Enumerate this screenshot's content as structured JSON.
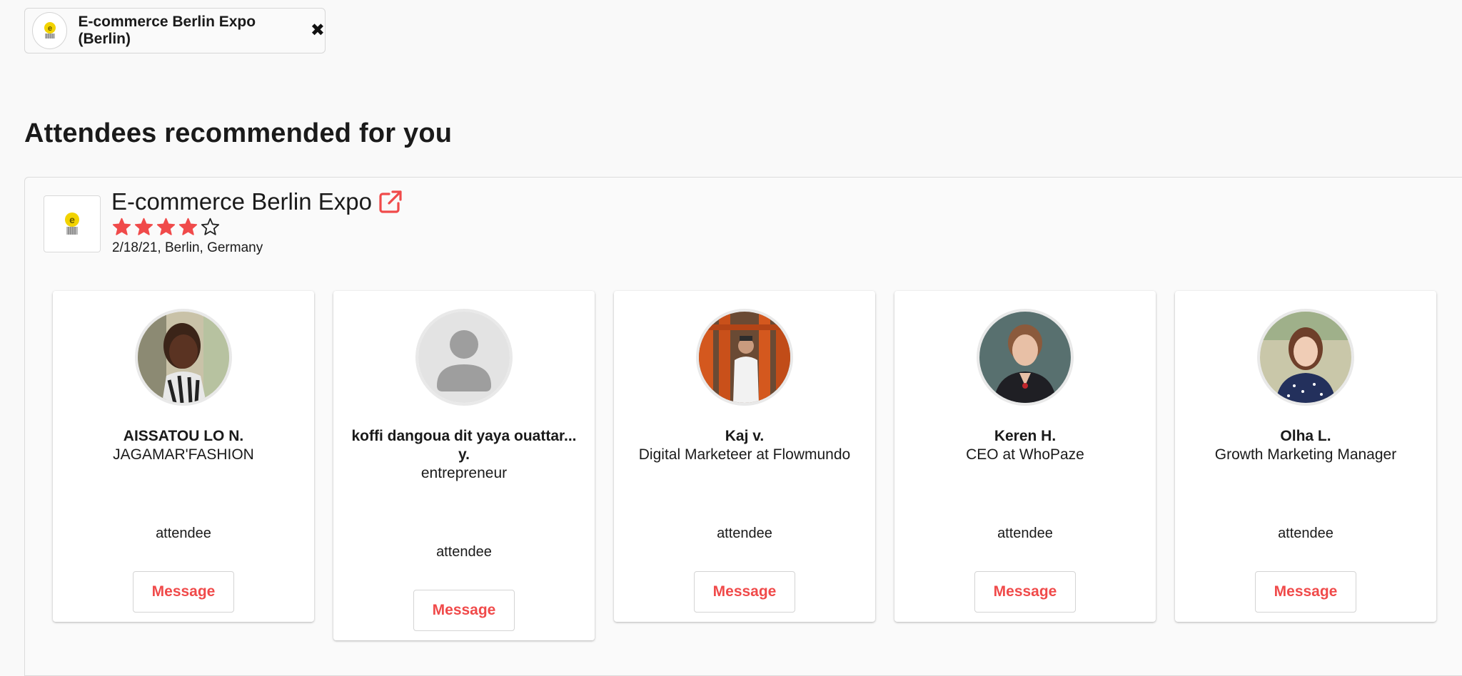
{
  "filter_chip": {
    "label": "E-commerce Berlin Expo (Berlin)",
    "logo_icon": "ecommerce-logo",
    "close_icon": "close-x-icon"
  },
  "section": {
    "title": "Attendees recommended for you"
  },
  "event": {
    "name": "E-commerce Berlin Expo",
    "rating": 4,
    "rating_max": 5,
    "meta": "2/18/21, Berlin, Germany",
    "accent_color": "#f04a4a",
    "link_icon": "external-link-icon"
  },
  "attendees": [
    {
      "name": "AISSATOU LO N.",
      "title": "JAGAMAR'FASHION",
      "role": "attendee",
      "button": "Message"
    },
    {
      "name": "koffi dangoua dit yaya ouattar... y.",
      "title": "entrepreneur",
      "role": "attendee",
      "button": "Message"
    },
    {
      "name": "Kaj v.",
      "title": "Digital Marketeer at Flowmundo",
      "role": "attendee",
      "button": "Message"
    },
    {
      "name": "Keren H.",
      "title": "CEO at WhoPaze",
      "role": "attendee",
      "button": "Message"
    },
    {
      "name": "Olha L.",
      "title": "Growth Marketing Manager",
      "role": "attendee",
      "button": "Message"
    }
  ]
}
